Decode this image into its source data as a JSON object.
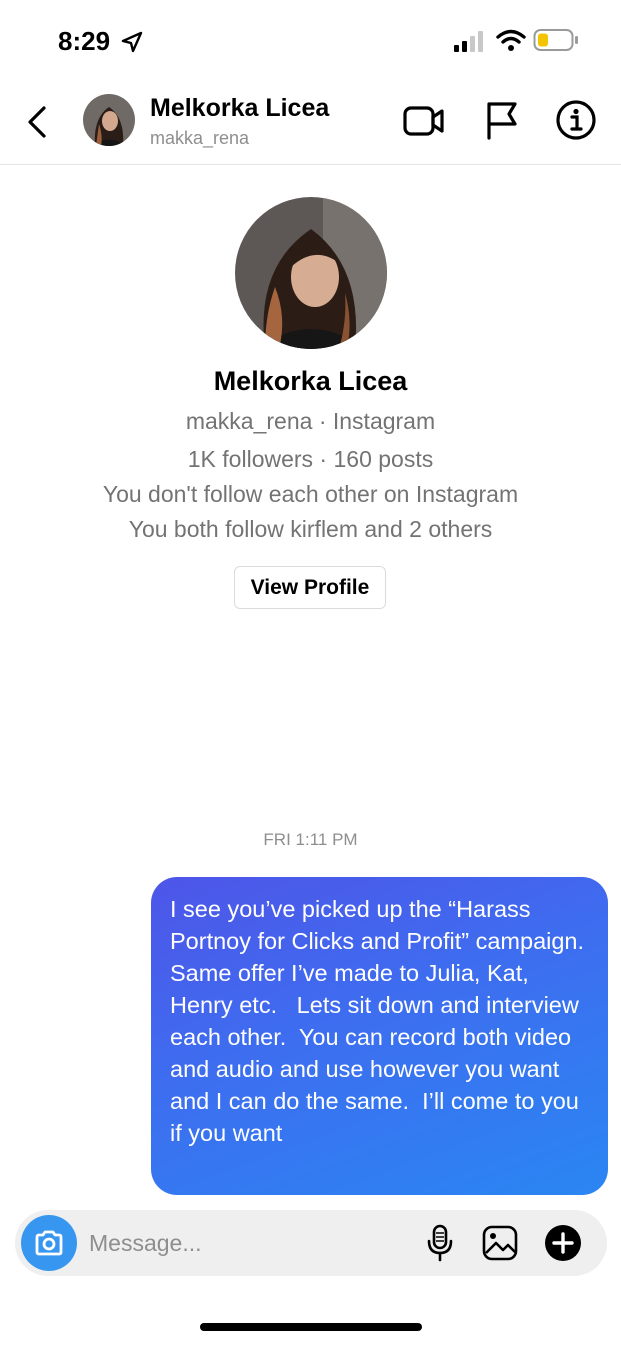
{
  "status_bar": {
    "time": "8:29",
    "battery_color": "#f5c400"
  },
  "header": {
    "name": "Melkorka Licea",
    "username": "makka_rena"
  },
  "profile": {
    "name": "Melkorka Licea",
    "handle_line": "makka_rena · Instagram",
    "stats_line": "1K followers · 160 posts",
    "follow_line": "You don't follow each other on Instagram",
    "mutual_line": "You both follow kirflem and 2 others",
    "view_profile_label": "View Profile"
  },
  "thread": {
    "timestamp": "FRI 1:11 PM",
    "messages": [
      {
        "from": "me",
        "text": "I see you’ve picked up the “Harass Portnoy for Clicks and Profit” campaign.  Same offer I’ve made to Julia, Kat, Henry etc.   Lets sit down and interview each other.  You can record both video and audio and use however you want and I can do the same.  I’ll come to you if you want"
      }
    ]
  },
  "composer": {
    "placeholder": "Message..."
  },
  "colors": {
    "accent": "#3797f0",
    "bubble_start": "#4e55e8",
    "bubble_end": "#2a86f2"
  },
  "icons": [
    "location-arrow-icon",
    "signal-icon",
    "wifi-icon",
    "battery-icon",
    "back-icon",
    "video-call-icon",
    "flag-icon",
    "info-icon",
    "camera-icon",
    "microphone-icon",
    "gallery-icon",
    "plus-icon"
  ]
}
